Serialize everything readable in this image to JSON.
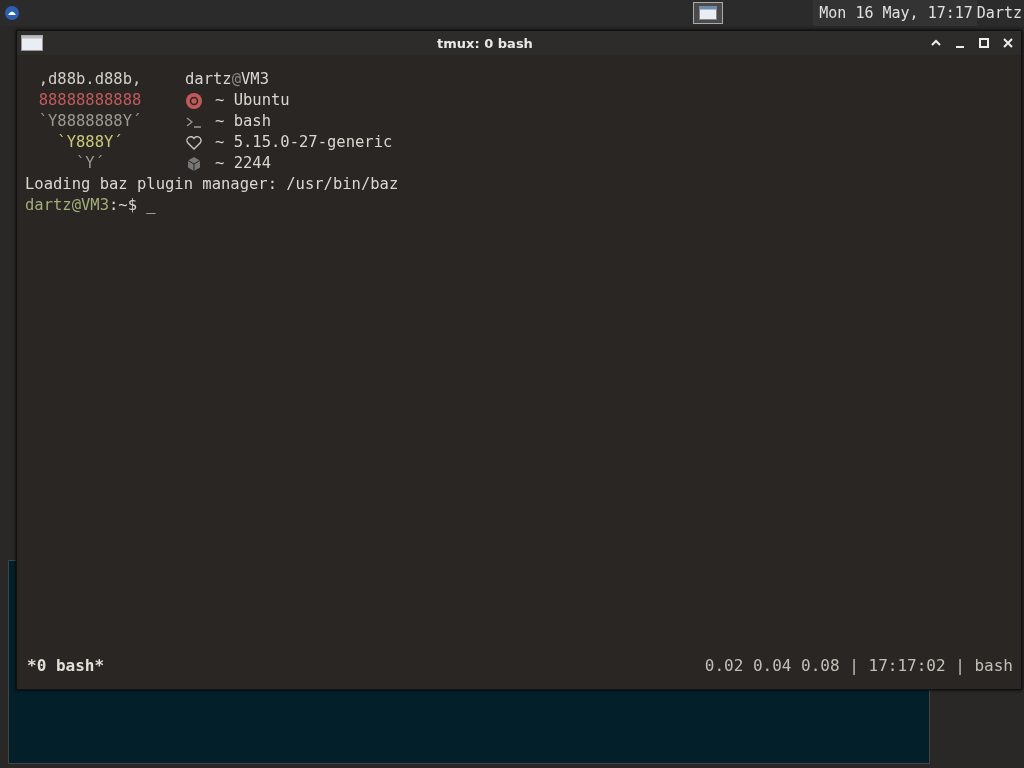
{
  "panel": {
    "clock": "Mon 16 May, 17:17",
    "user": "Dartz"
  },
  "window": {
    "title": "tmux: 0 bash"
  },
  "fetch": {
    "logo": [
      {
        "text": ",d88b.d88b,",
        "color": "#d0d0c8"
      },
      {
        "text": "88888888888",
        "color": "#c05a5a"
      },
      {
        "text": "`Y8888888Y´",
        "color": "#9a9a90"
      },
      {
        "text": "`Y888Y´",
        "color": "#c8c87a"
      },
      {
        "text": "`Y´",
        "color": "#9a9a90"
      }
    ],
    "header": {
      "user": "dartz",
      "sep": "@",
      "host": "VM3"
    },
    "info": [
      {
        "kind": "os",
        "text": "~ Ubuntu"
      },
      {
        "kind": "shell",
        "text": "~ bash"
      },
      {
        "kind": "kernel",
        "text": "~ 5.15.0-27-generic"
      },
      {
        "kind": "packages",
        "text": "~ 2244"
      }
    ]
  },
  "output": "Loading baz plugin manager: /usr/bin/baz",
  "prompt": {
    "user_host": "dartz@VM3",
    "path": ":~$",
    "cursor": "_"
  },
  "status_bar": {
    "window": "*0 bash*",
    "right": "0.02 0.04 0.08 | 17:17:02 | bash"
  }
}
